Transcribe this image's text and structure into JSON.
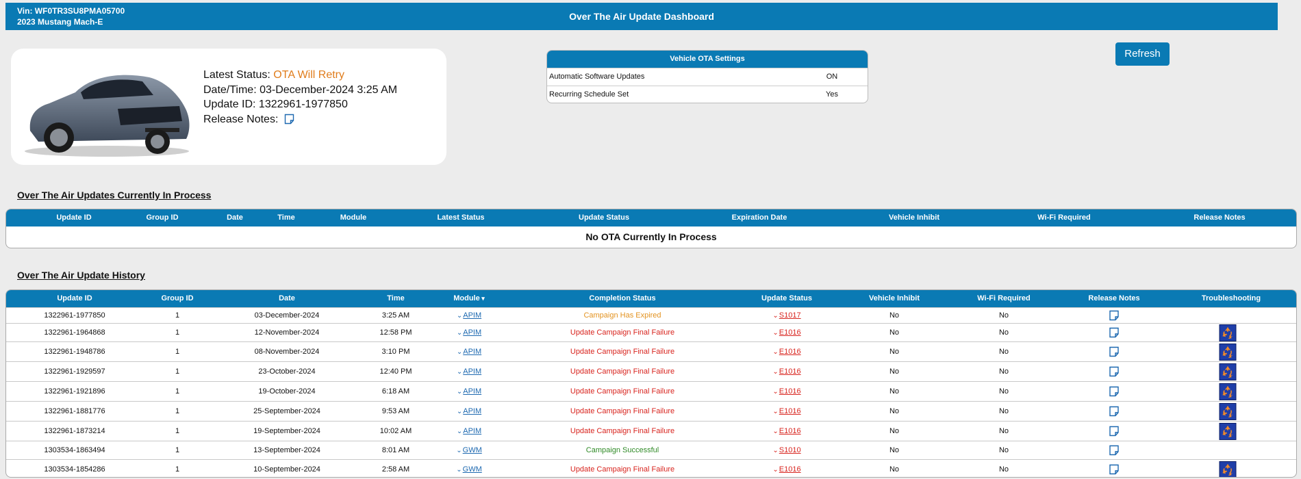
{
  "header": {
    "vin": "Vin: WF0TR3SU8PMA05700",
    "vehicle": "2023 Mustang Mach-E",
    "title": "Over The Air Update Dashboard"
  },
  "latest": {
    "status_label": "Latest Status:",
    "status_value": "OTA Will Retry",
    "datetime": "Date/Time: 03-December-2024 3:25 AM",
    "update_id": "Update ID: 1322961-1977850",
    "release_notes_label": "Release Notes:"
  },
  "settings": {
    "title": "Vehicle OTA Settings",
    "rows": [
      {
        "label": "Automatic Software Updates",
        "value": "ON"
      },
      {
        "label": "Recurring Schedule Set",
        "value": "Yes"
      }
    ]
  },
  "refresh_label": "Refresh",
  "in_process": {
    "title": "Over The Air Updates Currently In Process",
    "headers": [
      "Update ID",
      "Group ID",
      "Date",
      "Time",
      "Module",
      "Latest Status",
      "Update Status",
      "Expiration Date",
      "Vehicle Inhibit",
      "Wi-Fi Required",
      "Release Notes"
    ],
    "empty_message": "No OTA Currently In Process"
  },
  "history": {
    "title": "Over The Air Update History",
    "headers": [
      "Update ID",
      "Group ID",
      "Date",
      "Time",
      "Module",
      "Completion Status",
      "Update Status",
      "Vehicle Inhibit",
      "Wi-Fi Required",
      "Release Notes",
      "Troubleshooting"
    ],
    "sort_indicator": "▾",
    "rows": [
      {
        "update_id": "1322961-1977850",
        "group_id": "1",
        "date": "03-December-2024",
        "time": "3:25 AM",
        "module": "APIM",
        "completion": "Campaign Has Expired",
        "completion_color": "orange",
        "update_status": "S1017",
        "inhibit": "No",
        "wifi": "No",
        "troubleshoot": false
      },
      {
        "update_id": "1322961-1964868",
        "group_id": "1",
        "date": "12-November-2024",
        "time": "12:58 PM",
        "module": "APIM",
        "completion": "Update Campaign Final Failure",
        "completion_color": "red",
        "update_status": "E1016",
        "inhibit": "No",
        "wifi": "No",
        "troubleshoot": true
      },
      {
        "update_id": "1322961-1948786",
        "group_id": "1",
        "date": "08-November-2024",
        "time": "3:10 PM",
        "module": "APIM",
        "completion": "Update Campaign Final Failure",
        "completion_color": "red",
        "update_status": "E1016",
        "inhibit": "No",
        "wifi": "No",
        "troubleshoot": true
      },
      {
        "update_id": "1322961-1929597",
        "group_id": "1",
        "date": "23-October-2024",
        "time": "12:40 PM",
        "module": "APIM",
        "completion": "Update Campaign Final Failure",
        "completion_color": "red",
        "update_status": "E1016",
        "inhibit": "No",
        "wifi": "No",
        "troubleshoot": true
      },
      {
        "update_id": "1322961-1921896",
        "group_id": "1",
        "date": "19-October-2024",
        "time": "6:18 AM",
        "module": "APIM",
        "completion": "Update Campaign Final Failure",
        "completion_color": "red",
        "update_status": "E1016",
        "inhibit": "No",
        "wifi": "No",
        "troubleshoot": true
      },
      {
        "update_id": "1322961-1881776",
        "group_id": "1",
        "date": "25-September-2024",
        "time": "9:53 AM",
        "module": "APIM",
        "completion": "Update Campaign Final Failure",
        "completion_color": "red",
        "update_status": "E1016",
        "inhibit": "No",
        "wifi": "No",
        "troubleshoot": true
      },
      {
        "update_id": "1322961-1873214",
        "group_id": "1",
        "date": "19-September-2024",
        "time": "10:02 AM",
        "module": "APIM",
        "completion": "Update Campaign Final Failure",
        "completion_color": "red",
        "update_status": "E1016",
        "inhibit": "No",
        "wifi": "No",
        "troubleshoot": true
      },
      {
        "update_id": "1303534-1863494",
        "group_id": "1",
        "date": "13-September-2024",
        "time": "8:01 AM",
        "module": "GWM",
        "completion": "Campaign Successful",
        "completion_color": "green",
        "update_status": "S1010",
        "inhibit": "No",
        "wifi": "No",
        "troubleshoot": false
      },
      {
        "update_id": "1303534-1854286",
        "group_id": "1",
        "date": "10-September-2024",
        "time": "2:58 AM",
        "module": "GWM",
        "completion": "Update Campaign Final Failure",
        "completion_color": "red",
        "update_status": "E1016",
        "inhibit": "No",
        "wifi": "No",
        "troubleshoot": true
      }
    ]
  },
  "colors": {
    "brand_blue": "#0a7ab4",
    "failure_red": "#d8231d",
    "expired_orange": "#e3921f",
    "success_green": "#2f8a26"
  },
  "icons": {
    "release_notes": "note-icon",
    "troubleshooting": "recycle-icon",
    "module_expand": "chevron-down-icon"
  }
}
